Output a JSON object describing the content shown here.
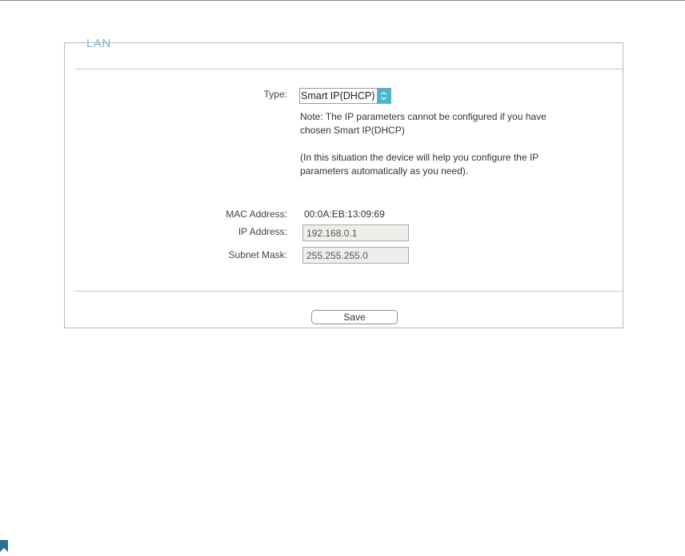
{
  "section": {
    "title": "LAN"
  },
  "type": {
    "label": "Type:",
    "selected": "Smart IP(DHCP)"
  },
  "notes": {
    "line1": "Note: The IP parameters cannot be configured if you have",
    "line2": "chosen Smart IP(DHCP)",
    "line3": "(In this situation the device will help you configure the IP",
    "line4": "parameters automatically as you need)."
  },
  "mac": {
    "label": "MAC Address:",
    "value": "00:0A:EB:13:09:69"
  },
  "ip": {
    "label": "IP Address:",
    "value": "192.168.0.1"
  },
  "subnet": {
    "label": "Subnet Mask:",
    "value": "255.255.255.0"
  },
  "actions": {
    "save_label": "Save"
  },
  "colors": {
    "accent": "#41b9cf",
    "title": "#7fb3d3",
    "divider": "#cfc6b8"
  },
  "icons": {
    "select_arrow": "chevron-updown-icon",
    "corner": "bookmark-icon"
  }
}
